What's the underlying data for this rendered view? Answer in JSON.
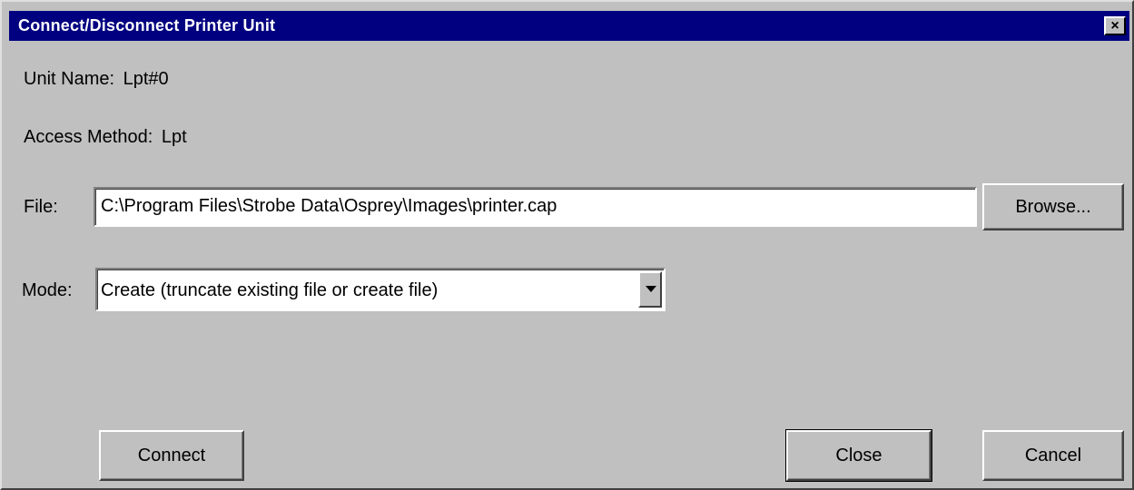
{
  "dialog": {
    "title": "Connect/Disconnect Printer Unit",
    "close_glyph": "×"
  },
  "info": {
    "unit_name_label": "Unit Name:",
    "unit_name_value": "Lpt#0",
    "access_method_label": "Access Method:",
    "access_method_value": "Lpt"
  },
  "file": {
    "label": "File:",
    "value": "C:\\Program Files\\Strobe Data\\Osprey\\Images\\printer.cap",
    "browse_label": "Browse..."
  },
  "mode": {
    "label": "Mode:",
    "selected": "Create (truncate existing file or create file)"
  },
  "buttons": {
    "connect_label": "Connect",
    "close_label": "Close",
    "cancel_label": "Cancel"
  },
  "icons": {
    "close": "close-icon",
    "dropdown": "chevron-down-icon"
  },
  "colors": {
    "titlebar": "#000080",
    "face": "#c0c0c0"
  }
}
